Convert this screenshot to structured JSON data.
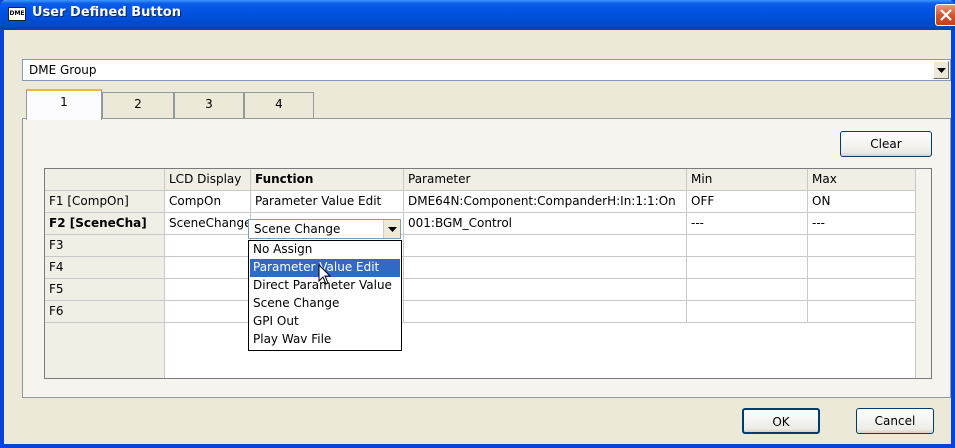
{
  "window": {
    "title": "User Defined Button",
    "app_icon_text": "DME"
  },
  "group_combo": {
    "value": "DME Group"
  },
  "tabs": [
    {
      "label": "1",
      "active": true
    },
    {
      "label": "2",
      "active": false
    },
    {
      "label": "3",
      "active": false
    },
    {
      "label": "4",
      "active": false
    }
  ],
  "buttons": {
    "clear": "Clear",
    "ok": "OK",
    "cancel": "Cancel"
  },
  "grid": {
    "columns": [
      "LCD Display",
      "Function",
      "Parameter",
      "Min",
      "Max"
    ],
    "rows": [
      {
        "name": "F1 [CompOn]",
        "lcd": "CompOn",
        "function": "Parameter Value Edit",
        "parameter": "DME64N:Component:CompanderH:In:1:1:On",
        "min": "OFF",
        "max": "ON"
      },
      {
        "name": "F2 [SceneCha]",
        "lcd": "SceneChange",
        "function": "Scene Change",
        "parameter": "001:BGM_Control",
        "min": "---",
        "max": "---"
      },
      {
        "name": "F3",
        "lcd": "",
        "function": "",
        "parameter": "",
        "min": "",
        "max": ""
      },
      {
        "name": "F4",
        "lcd": "",
        "function": "",
        "parameter": "",
        "min": "",
        "max": ""
      },
      {
        "name": "F5",
        "lcd": "",
        "function": "",
        "parameter": "",
        "min": "",
        "max": ""
      },
      {
        "name": "F6",
        "lcd": "",
        "function": "",
        "parameter": "",
        "min": "",
        "max": ""
      }
    ]
  },
  "function_dropdown": {
    "current": "Scene Change",
    "options": [
      "No Assign",
      "Parameter Value Edit",
      "Direct Parameter Value",
      "Scene Change",
      "GPI Out",
      "Play Wav File"
    ],
    "highlighted": "Parameter Value Edit"
  },
  "colors": {
    "title_bar": "#0054e3",
    "selection": "#316ac5",
    "dialog_bg": "#ece9d8"
  }
}
